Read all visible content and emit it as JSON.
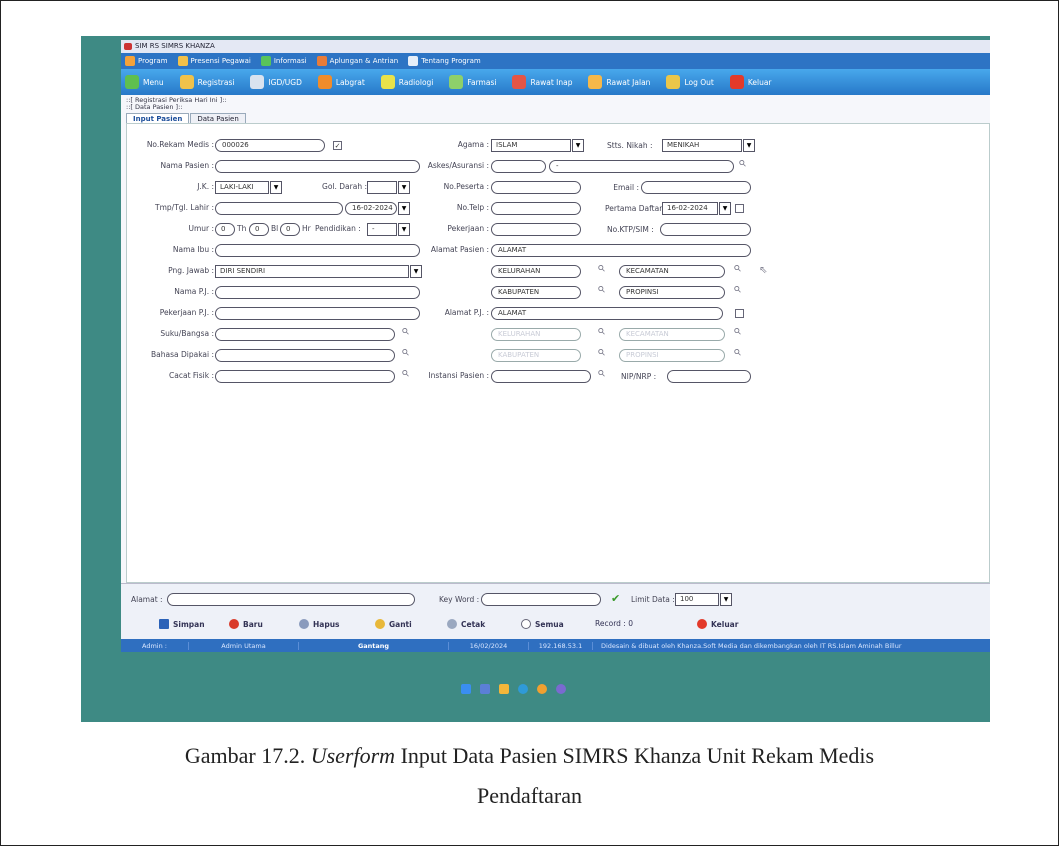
{
  "window": {
    "title": "SIM RS SIMRS KHANZA"
  },
  "menubar": [
    "Program",
    "Presensi Pegawai",
    "Informasi",
    "Aplungan & Antrian",
    "Tentang Program"
  ],
  "toolbar": [
    "Menu",
    "Registrasi",
    "IGD/UGD",
    "Labgrat",
    "Radiologi",
    "Farmasi",
    "Rawat Inap",
    "Rawat Jalan",
    "Log Out",
    "Keluar"
  ],
  "frame": {
    "title": "::[ Registrasi Periksa Hari Ini ]::",
    "subtitle": "::[ Data Pasien ]::"
  },
  "tabs": [
    "Input Pasien",
    "Data Pasien"
  ],
  "form": {
    "no_rm_label": "No.Rekam Medis :",
    "no_rm": "000026",
    "nama_label": "Nama Pasien :",
    "jk_label": "J.K. :",
    "jk": "LAKI-LAKI",
    "gol_label": "Gol. Darah :",
    "tmp_label": "Tmp/Tgl. Lahir :",
    "tgl_lahir": "16-02-2024",
    "umur_label": "Umur :",
    "umur_th": "0",
    "th": "Th",
    "umur_bl": "0",
    "bl": "Bl",
    "umur_hr": "0",
    "hr": "Hr",
    "pendidikan_label": "Pendidikan :",
    "pendidikan": "-",
    "ibu_label": "Nama Ibu :",
    "pngjawab_label": "Png. Jawab :",
    "pngjawab": "DIRI SENDIRI",
    "namapj_label": "Nama P.J. :",
    "pekerjaanpj_label": "Pekerjaan P.J. :",
    "suku_label": "Suku/Bangsa :",
    "bahasa_label": "Bahasa Dipakai :",
    "cacat_label": "Cacat Fisik :",
    "agama_label": "Agama :",
    "agama": "ISLAM",
    "stts_label": "Stts. Nikah :",
    "stts": "MENIKAH",
    "askes_label": "Askes/Asuransi :",
    "askes2": "-",
    "peserta_label": "No.Peserta :",
    "email_label": "Email :",
    "telp_label": "No.Telp :",
    "daftar_label": "Pertama Daftar :",
    "tgl_daftar": "16-02-2024",
    "pekerjaan_label": "Pekerjaan :",
    "ktp_label": "No.KTP/SIM :",
    "alamat_label": "Alamat Pasien :",
    "alamat": "ALAMAT",
    "kelurahan": "KELURAHAN",
    "kecamatan": "KECAMATAN",
    "kabupaten": "KABUPATEN",
    "propinsi": "PROPINSI",
    "alamatpj_label": "Alamat P.J. :",
    "alamatpj": "ALAMAT",
    "kelurahan2": "KELURAHAN",
    "kecamatan2": "KECAMATAN",
    "kabupaten2": "KABUPATEN",
    "propinsi2": "PROPINSI",
    "instansi_label": "Instansi Pasien :",
    "nip_label": "NIP/NRP :"
  },
  "bottom": {
    "alamat_label": "Alamat :",
    "keyword_label": "Key Word :",
    "limit_label": "Limit Data :",
    "limit": "100",
    "buttons": [
      "Simpan",
      "Baru",
      "Hapus",
      "Ganti",
      "Cetak",
      "Semua",
      "Record : 0",
      "Keluar"
    ]
  },
  "status": [
    "Admin :",
    "Admin Utama",
    "Gantang",
    "16/02/2024",
    "192.168.53.1",
    "Didesain & dibuat oleh Khanza.Soft Media dan dikembangkan oleh IT RS.Islam Aminah Billur"
  ],
  "caption": {
    "line1_pre": "Gambar 17.2. ",
    "line1_em": "Userform",
    "line1_post": " Input Data Pasien SIMRS Khanza Unit Rekam Medis",
    "line2": "Pendaftaran"
  },
  "colors": {
    "menubar": "#2d74c4",
    "toolbar": "#3b93dd",
    "statusbar": "#2f6fc0",
    "photo_bg": "#3e8a84"
  }
}
